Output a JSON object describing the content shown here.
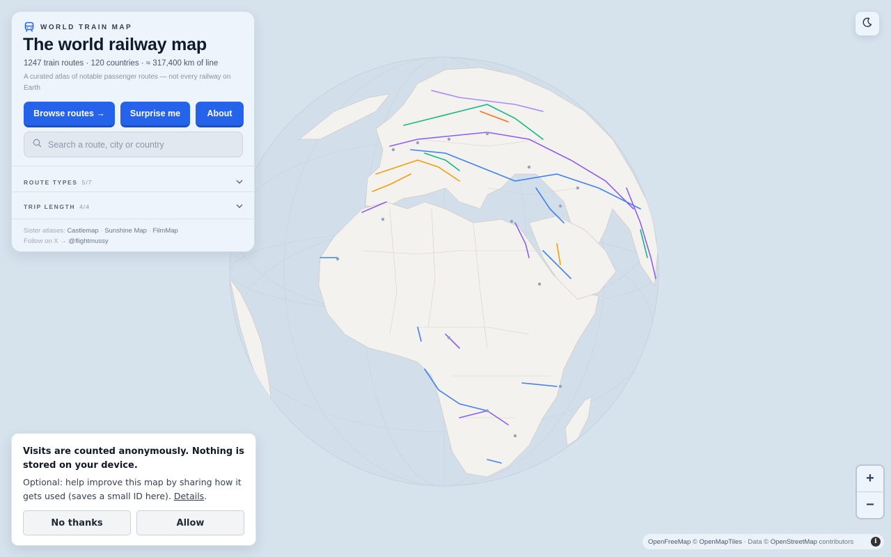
{
  "brand": {
    "label": "WORLD TRAIN MAP",
    "icon": "train-icon"
  },
  "title": "The world railway map",
  "stats": "1247 train routes · 120 countries · ≈ 317,400 km of line",
  "subtitle": "A curated atlas of notable passenger routes — not every railway on Earth",
  "buttons": {
    "browse": "Browse routes →",
    "surprise": "Surprise me",
    "about": "About"
  },
  "search": {
    "placeholder": "Search a route, city or country",
    "value": "",
    "icon": "search-icon"
  },
  "filters": [
    {
      "label": "ROUTE TYPES",
      "count": "5/7",
      "icon": "chevron-down-icon"
    },
    {
      "label": "TRIP LENGTH",
      "count": "4/4",
      "icon": "chevron-down-icon"
    }
  ],
  "footer": {
    "sister_prefix": "Sister atlases:",
    "sister_links": [
      "Castlemap",
      "Sunshine Map",
      "FilmMap"
    ],
    "sep": "·",
    "follow_prefix": "Follow on X →",
    "follow_handle": "@flightmussy"
  },
  "theme_toggle": {
    "icon": "moon-icon"
  },
  "zoom": {
    "in": "+",
    "out": "−"
  },
  "attribution": {
    "p1": "OpenFreeMap",
    "p2": "©",
    "p3": "OpenMapTiles",
    "p4": "· Data ©",
    "p5": "OpenStreetMap",
    "p6": "contributors",
    "info": "i"
  },
  "consent": {
    "title": "Visits are counted anonymously. Nothing is stored on your device.",
    "body": "Optional: help improve this map by sharing how it gets used (saves a small ID here).",
    "details_link": "Details",
    "period": ".",
    "decline": "No thanks",
    "allow": "Allow"
  },
  "colors": {
    "accent": "#2563eb",
    "ocean": "#d6e2ec",
    "land": "#f4f2ee",
    "route_colors": [
      "#8b5cf6",
      "#f59e0b",
      "#10b981",
      "#3b82f6",
      "#a78bfa",
      "#f97316"
    ]
  }
}
